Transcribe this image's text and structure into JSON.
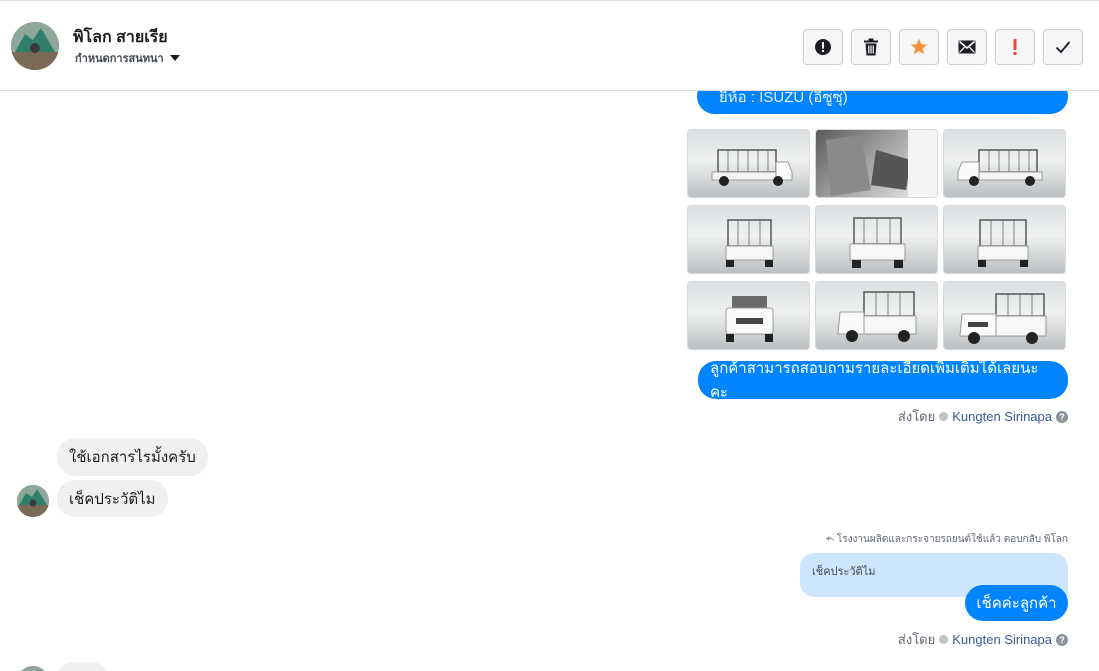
{
  "header": {
    "contact_name": "พิโลก สายเรีย",
    "subtitle": "กำหนดการสนทนา"
  },
  "toolbar": {
    "buttons": [
      {
        "icon": "alert-circle-icon",
        "color": "#1c1e21"
      },
      {
        "icon": "trash-icon",
        "color": "#1c1e21"
      },
      {
        "icon": "star-icon",
        "color": "#f7923b"
      },
      {
        "icon": "envelope-icon",
        "color": "#1c1e21"
      },
      {
        "icon": "exclamation-icon",
        "color": "#fa3e3e"
      },
      {
        "icon": "check-icon",
        "color": "#1c1e21"
      }
    ]
  },
  "messages": {
    "brand_line": "ยี่ห้อ : ISUZU (อีซูซุ)",
    "photo_count": 9,
    "customer_info": "ลูกค้าสามารถสอบถามรายละเอียดเพิ่มเติมได้เลยนะคะ",
    "sent_by_label_1": "ส่งโดย",
    "sender_1": "Kungten Sirinapa",
    "incoming_1": "ใช้เอกสารไรมั้งครับ",
    "incoming_2": "เช็คประวัติไม",
    "reply_note": "โรงงานผลิตและกระจายรถยนต์ใช้แล้ว ตอบกลับ พิโลก",
    "quoted": "เช็คประวัติไม",
    "reply": "เช็คค่ะลูกค้า",
    "sent_by_label_2": "ส่งโดย",
    "sender_2": "Kungten Sirinapa"
  },
  "colors": {
    "brand_blue": "#0084ff",
    "quote_bg": "#cde5ff",
    "incoming_bg": "#f0f0f0",
    "link": "#385898"
  }
}
